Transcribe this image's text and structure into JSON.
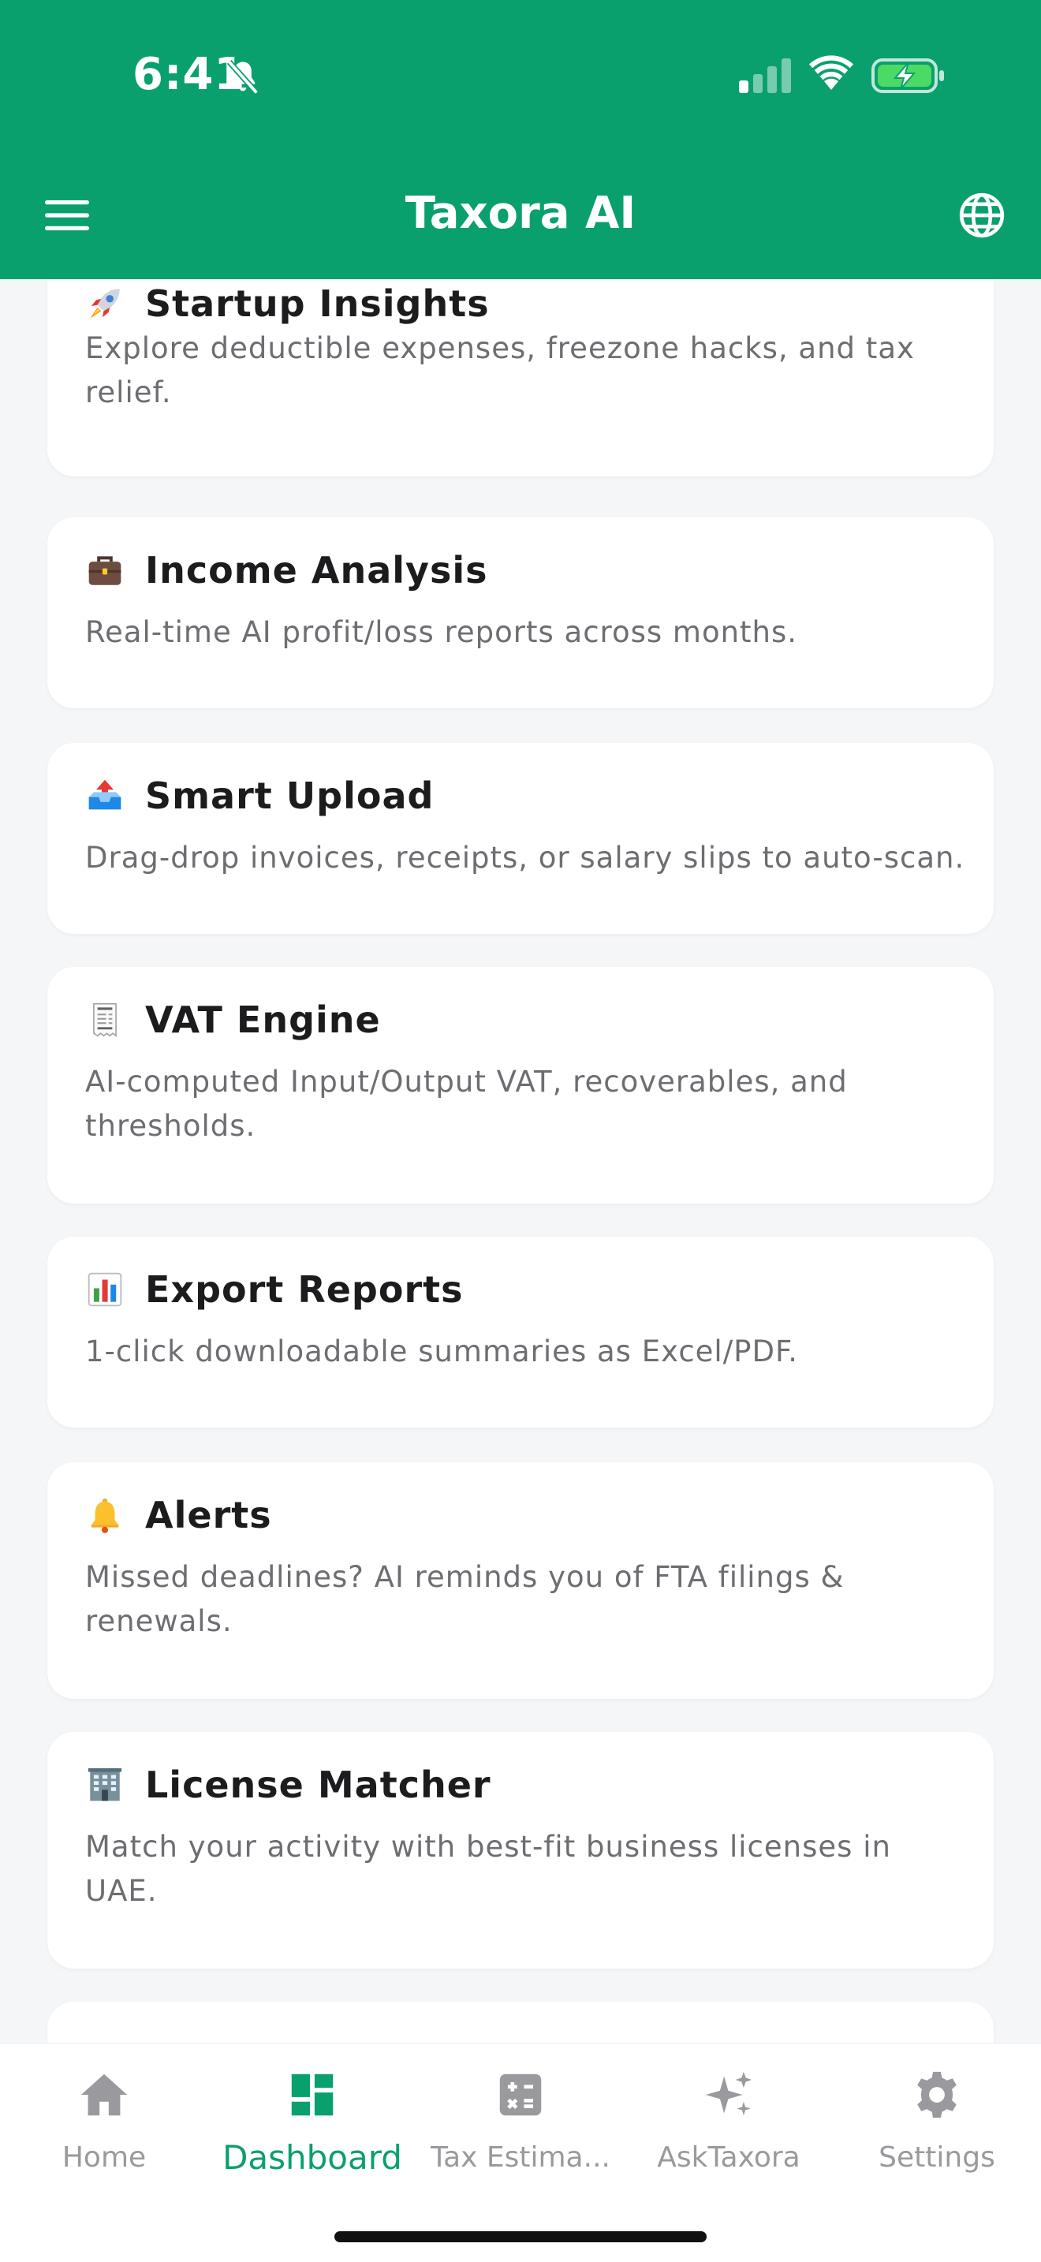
{
  "status_bar": {
    "time": "6:41"
  },
  "header": {
    "title": "Taxora AI"
  },
  "cards": [
    {
      "title": "Startup Insights",
      "description": "Explore deductible expenses, freezone hacks, and tax relief."
    },
    {
      "title": "Income Analysis",
      "description": "Real-time AI profit/loss reports across months."
    },
    {
      "title": "Smart Upload",
      "description": "Drag-drop invoices, receipts, or salary slips to auto-scan."
    },
    {
      "title": "VAT Engine",
      "description": "AI-computed Input/Output VAT, recoverables, and thresholds."
    },
    {
      "title": "Export Reports",
      "description": "1-click downloadable summaries as Excel/PDF."
    },
    {
      "title": "Alerts",
      "description": "Missed deadlines? AI reminds you of FTA filings & renewals."
    },
    {
      "title": "License Matcher",
      "description": "Match your activity with best-fit business licenses in UAE."
    }
  ],
  "tabs": [
    {
      "label": "Home",
      "icon": "home-icon"
    },
    {
      "label": "Dashboard",
      "icon": "dashboard-icon",
      "active": true
    },
    {
      "label": "Tax Estima...",
      "icon": "calculator-icon"
    },
    {
      "label": "AskTaxora",
      "icon": "sparkles-icon"
    },
    {
      "label": "Settings",
      "icon": "gear-icon"
    }
  ],
  "colors": {
    "brand": "#0aa06e",
    "background": "#f5f6f8",
    "card": "#ffffff",
    "muted_text": "#6d6d72",
    "inactive_tab": "#9a9a9e"
  }
}
